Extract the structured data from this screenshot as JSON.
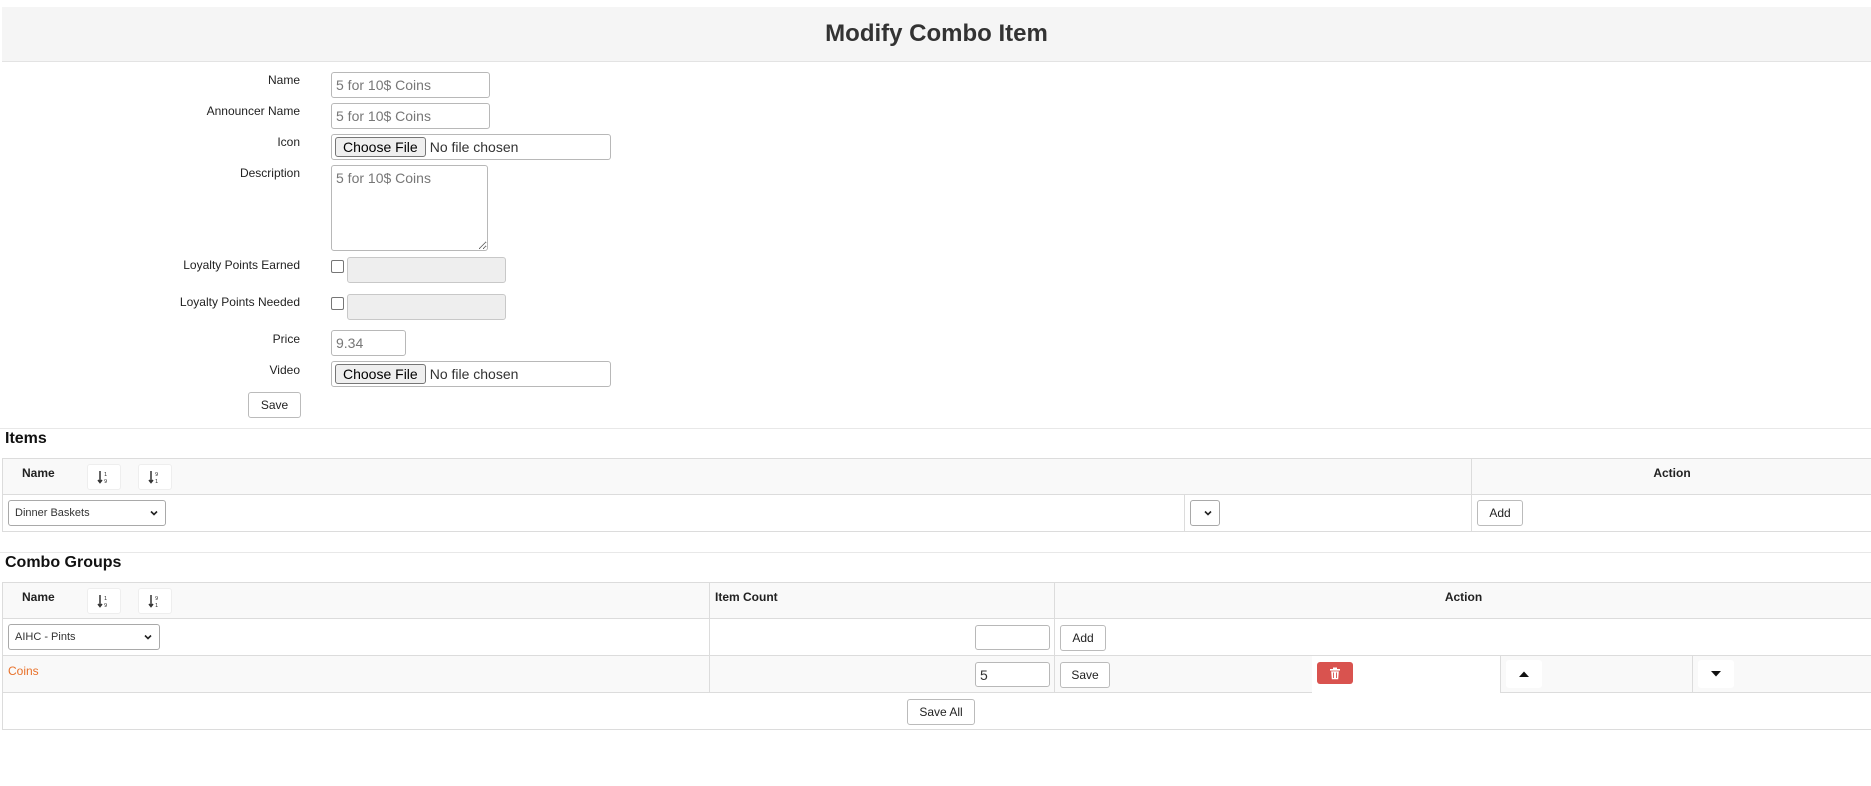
{
  "page": {
    "title": "Modify Combo Item"
  },
  "form": {
    "name": {
      "label": "Name",
      "value": "5 for 10$ Coins"
    },
    "announcer_name": {
      "label": "Announcer Name",
      "value": "5 for 10$ Coins"
    },
    "icon": {
      "label": "Icon",
      "button": "Choose File",
      "status": "No file chosen"
    },
    "description": {
      "label": "Description",
      "value": "5 for 10$ Coins"
    },
    "loyalty_points_earned": {
      "label": "Loyalty Points Earned",
      "checked": false,
      "value": ""
    },
    "loyalty_points_needed": {
      "label": "Loyalty Points Needed",
      "checked": false,
      "value": ""
    },
    "price": {
      "label": "Price",
      "value": "9.34"
    },
    "video": {
      "label": "Video",
      "button": "Choose File",
      "status": "No file chosen"
    },
    "save_label": "Save"
  },
  "items": {
    "title": "Items",
    "columns": {
      "name": "Name",
      "action": "Action"
    },
    "add_row": {
      "select_value": "Dinner Baskets",
      "secondary_select_value": "",
      "add_label": "Add"
    }
  },
  "combo_groups": {
    "title": "Combo Groups",
    "columns": {
      "name": "Name",
      "item_count": "Item Count",
      "action": "Action"
    },
    "add_row": {
      "select_value": "AIHC - Pints",
      "count_value": "",
      "add_label": "Add"
    },
    "rows": [
      {
        "name": "Coins",
        "item_count": "5",
        "save_label": "Save"
      }
    ],
    "save_all_label": "Save All"
  },
  "icons": {
    "sort_asc": "sort-numeric-asc-icon",
    "sort_desc": "sort-numeric-desc-icon",
    "delete": "trash-icon",
    "move_up": "caret-up-icon",
    "move_down": "caret-down-icon",
    "dropdown": "chevron-down-icon"
  },
  "colors": {
    "link": "#e8712a",
    "danger": "#d9534f",
    "header_bg": "#f5f5f5"
  }
}
